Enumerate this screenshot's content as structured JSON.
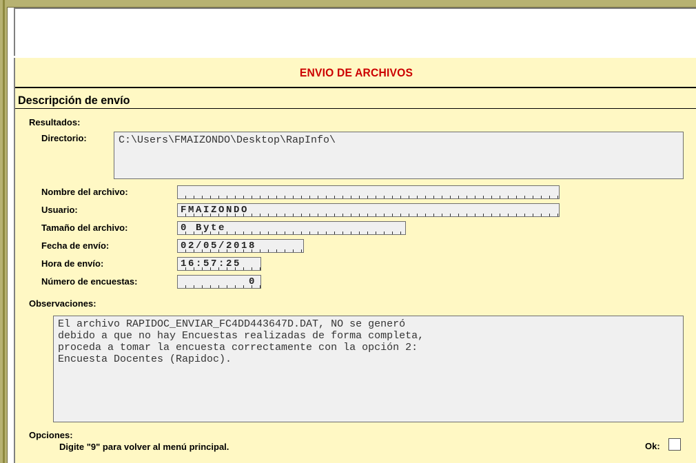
{
  "form": {
    "title": "ENVIO DE ARCHIVOS",
    "section_title": "Descripción de envío",
    "results_label": "Resultados:",
    "directory_label": "Directorio:",
    "directory_value": "C:\\Users\\FMAIZONDO\\Desktop\\RapInfo\\",
    "filename_label": "Nombre del archivo:",
    "filename_value": "",
    "user_label": "Usuario:",
    "user_value": "FMAIZONDO",
    "filesize_label": "Tamaño del archivo:",
    "filesize_value": "0 Byte",
    "date_label": "Fecha de envío:",
    "date_value": "02/05/2018",
    "time_label": "Hora de envío:",
    "time_value": "16:57:25",
    "surveys_label": "Número de encuestas:",
    "surveys_value": "0",
    "observations_label": "Observaciones:",
    "observations_value": "El archivo RAPIDOC_ENVIAR_FC4DD443647D.DAT, NO se generó\ndebido a que no hay Encuestas realizadas de forma completa,\nproceda a tomar la encuesta correctamente con la opción 2:\nEncuesta Docentes (Rapidoc).",
    "options_label": "Opciones:",
    "options_hint": "Digite \"9\" para volver al menú principal.",
    "ok_label": "Ok:"
  },
  "colors": {
    "form_background": "#fff8c4",
    "title_red": "#cc0000",
    "frame": "#b7b272",
    "field_background": "#f0f0f0"
  }
}
